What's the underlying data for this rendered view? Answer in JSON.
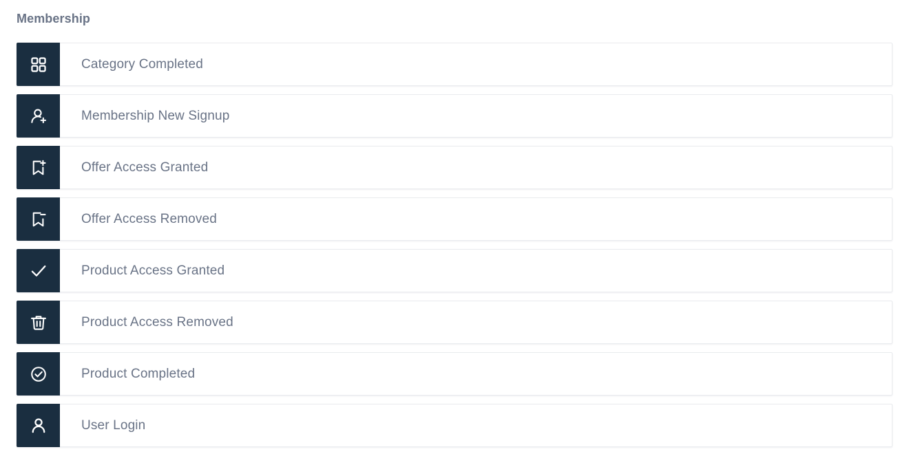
{
  "section": {
    "title": "Membership"
  },
  "colors": {
    "icon_box_background": "#1a2e40",
    "icon_glyph": "#ffffff",
    "label_text": "#697386",
    "title_text": "#697386",
    "row_background": "#ffffff",
    "row_border": "#e9ebee",
    "page_background": "#ffffff"
  },
  "events": [
    {
      "label": "Category Completed",
      "icon": "grid-squares-icon"
    },
    {
      "label": "Membership New Signup",
      "icon": "user-plus-icon"
    },
    {
      "label": "Offer Access Granted",
      "icon": "bookmark-plus-icon"
    },
    {
      "label": "Offer Access Removed",
      "icon": "bookmark-minus-icon"
    },
    {
      "label": "Product Access Granted",
      "icon": "check-icon"
    },
    {
      "label": "Product Access Removed",
      "icon": "trash-icon"
    },
    {
      "label": "Product Completed",
      "icon": "check-circle-icon"
    },
    {
      "label": "User Login",
      "icon": "user-icon"
    }
  ]
}
